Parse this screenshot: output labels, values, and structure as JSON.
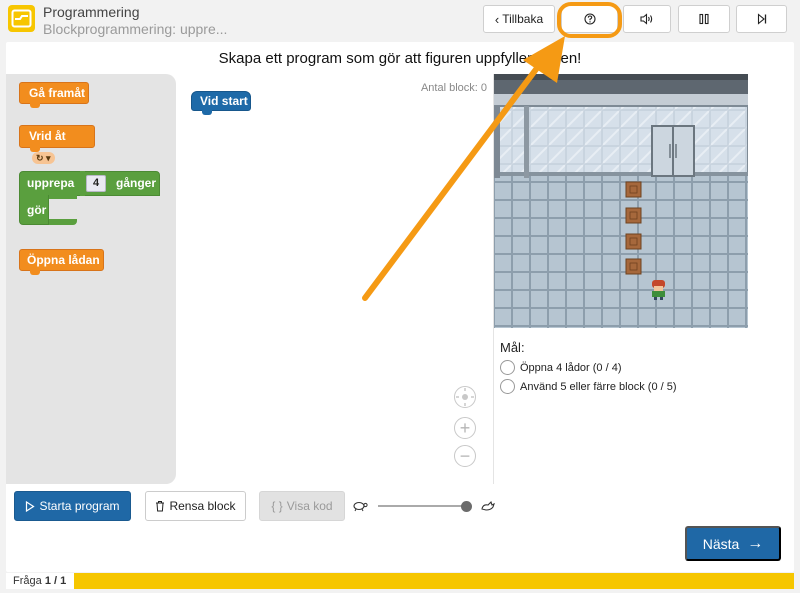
{
  "header": {
    "title": "Programmering",
    "subtitle": "Blockprogrammering: uppre...",
    "back_label": "Tillbaka",
    "help_icon": "help-circle-icon",
    "sound_icon": "speaker-icon",
    "pause_icon": "pause-icon",
    "skip_icon": "skip-forward-icon"
  },
  "instruction": "Skapa ett program som gör att figuren uppfyller målen!",
  "toolbox": {
    "move_forward": "Gå framåt",
    "turn": "Vrid åt",
    "turn_option": "↻",
    "repeat": "upprepa",
    "repeat_count": "4",
    "repeat_times": "gånger",
    "repeat_do": "gör",
    "open_box": "Öppna lådan"
  },
  "workspace": {
    "block_count": "Antal block: 0",
    "start_block": "Vid start"
  },
  "goals": {
    "title": "Mål:",
    "items": [
      "Öppna 4 lådor (0 / 4)",
      "Använd 5 eller färre block (0 / 5)"
    ]
  },
  "controls": {
    "start": "Starta program",
    "clear": "Rensa block",
    "show_code": "Visa kod",
    "next": "Nästa"
  },
  "footer": {
    "question_prefix": "Fråga",
    "question_number": "1 / 1",
    "progress": 1.0
  },
  "colors": {
    "accent_yellow": "#f6c600",
    "primary_blue": "#1f68a6",
    "block_orange": "#f28d1e",
    "block_green": "#5a9f3e",
    "annotation_orange": "#f59a14"
  }
}
